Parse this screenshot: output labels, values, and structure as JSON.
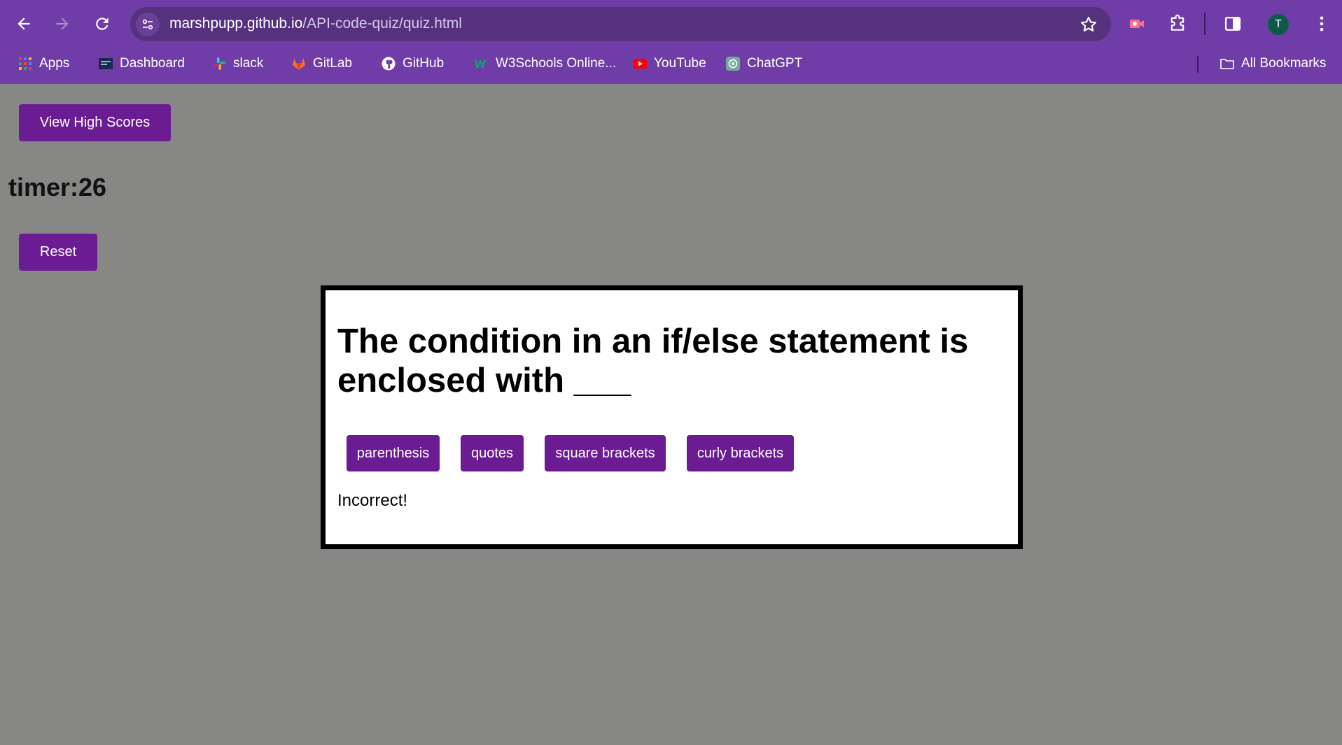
{
  "browser": {
    "url_host": "marshpupp.github.io",
    "url_path": "/API-code-quiz/quiz.html",
    "profile_initial": "T",
    "accent_color": "#6f3ca8",
    "bookmarks": [
      {
        "label": "Apps",
        "icon": "apps-grid-icon"
      },
      {
        "label": "Dashboard",
        "icon": "dashboard-icon"
      },
      {
        "label": "slack",
        "icon": "slack-icon"
      },
      {
        "label": "GitLab",
        "icon": "gitlab-icon"
      },
      {
        "label": "GitHub",
        "icon": "github-icon"
      },
      {
        "label": "W3Schools Online...",
        "icon": "w3schools-icon"
      },
      {
        "label": "YouTube",
        "icon": "youtube-icon"
      },
      {
        "label": "ChatGPT",
        "icon": "chatgpt-icon"
      }
    ],
    "all_bookmarks_label": "All Bookmarks"
  },
  "page": {
    "high_scores_label": "View High Scores",
    "timer_text": "timer:26",
    "reset_label": "Reset",
    "button_color": "#6b1c93",
    "background_color": "#878785"
  },
  "quiz": {
    "question": "The condition in an if/else statement is enclosed with ___",
    "answers": [
      "parenthesis",
      "quotes",
      "square brackets",
      "curly brackets"
    ],
    "feedback": "Incorrect!"
  }
}
